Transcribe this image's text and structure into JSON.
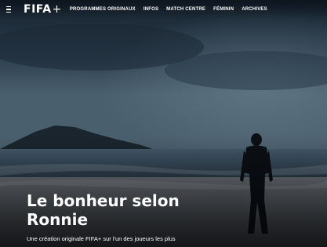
{
  "nav": {
    "logo": "FIFA",
    "logo_plus": "+",
    "menu_icon": "hamburger-menu-icon",
    "links": [
      "PROGRAMMES ORIGINAUX",
      "INFOS",
      "MATCH CENTRE",
      "FÉMININ",
      "ARCHIVES"
    ]
  },
  "hero": {
    "title_line1": "Le bonheur selon",
    "title_line2": "Ronnie",
    "subtitle": "Une création originale FIFA+ sur l'un des joueurs les plus"
  },
  "colors": {
    "sky_top": "#1d2e3c",
    "sea": "#2f4656",
    "sand": "#5a6068",
    "text": "#ffffff"
  }
}
